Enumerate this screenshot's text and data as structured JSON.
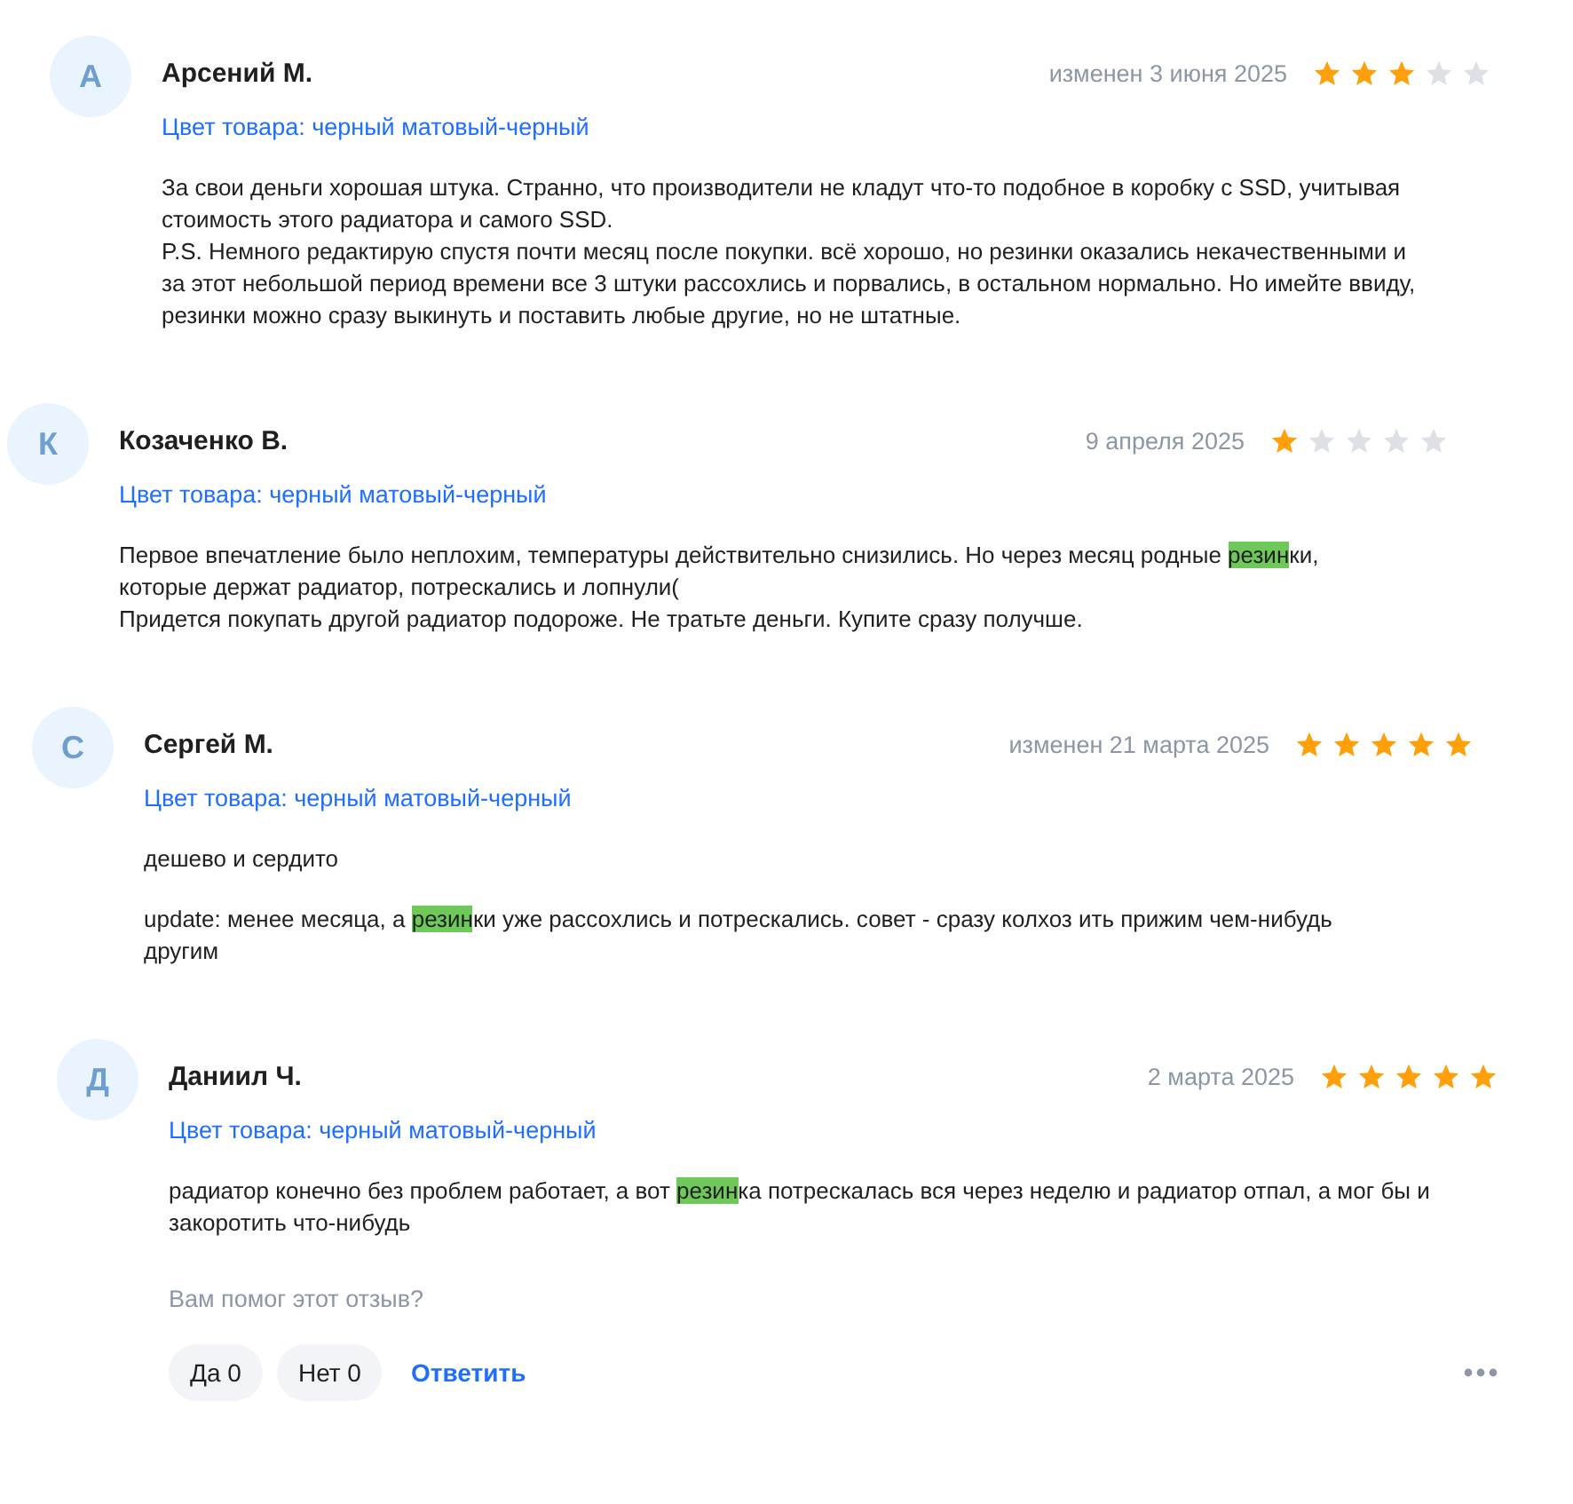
{
  "reviews": [
    {
      "avatar": "А",
      "author": "Арсений М.",
      "date": "изменен 3 июня 2025",
      "stars": 3,
      "variant": "Цвет товара: черный матовый-черный",
      "paragraphs": [
        [
          [
            {
              "text": "За свои деньги хорошая штука. Странно, что производители не кладут что-то подобное в коробку с SSD, учитывая стоимость этого радиатора и самого SSD.",
              "highlighted": false
            }
          ],
          [
            {
              "text": "P.S. Немного редактирую спустя почти месяц после покупки. всё хорошо, но резинки оказались некачественными и за этот небольшой период времени все 3 штуки рассохлись и порвались, в остальном нормально. Но имейте ввиду, резинки можно сразу выкинуть и поставить любые другие, но не штатные.",
              "highlighted": false
            }
          ]
        ]
      ]
    },
    {
      "avatar": "К",
      "author": "Козаченко В.",
      "date": "9 апреля 2025",
      "stars": 1,
      "variant": "Цвет товара: черный матовый-черный",
      "paragraphs": [
        [
          [
            {
              "text": "Первое впечатление было неплохим, температуры действительно снизились. Но через месяц родные ",
              "highlighted": false
            },
            {
              "text": "резин",
              "highlighted": true
            },
            {
              "text": "ки, которые держат радиатор, потрескались и лопнули(",
              "highlighted": false
            }
          ],
          [
            {
              "text": "Придется покупать другой радиатор подороже. Не тратьте деньги. Купите сразу получше.",
              "highlighted": false
            }
          ]
        ]
      ]
    },
    {
      "avatar": "С",
      "author": "Сергей М.",
      "date": "изменен 21 марта 2025",
      "stars": 5,
      "variant": "Цвет товара: черный матовый-черный",
      "paragraphs": [
        [
          [
            {
              "text": "дешево и сердито",
              "highlighted": false
            }
          ]
        ],
        [
          [
            {
              "text": "update: менее месяца, а ",
              "highlighted": false
            },
            {
              "text": "резин",
              "highlighted": true
            },
            {
              "text": "ки уже рассохлись и потрескались. совет - сразу колхоз ить прижим чем-нибудь другим",
              "highlighted": false
            }
          ]
        ]
      ]
    },
    {
      "avatar": "Д",
      "author": "Даниил Ч.",
      "date": "2 марта 2025",
      "stars": 5,
      "variant": "Цвет товара: черный матовый-черный",
      "paragraphs": [
        [
          [
            {
              "text": "радиатор конечно без проблем работает, а вот ",
              "highlighted": false
            },
            {
              "text": "резин",
              "highlighted": true
            },
            {
              "text": "ка потрескалась вся через неделю и радиатор отпал, а мог бы и закоротить что-нибудь",
              "highlighted": false
            }
          ]
        ]
      ],
      "feedback": {
        "question": "Вам помог этот отзыв?",
        "yes": "Да 0",
        "no": "Нет 0",
        "reply": "Ответить"
      }
    }
  ]
}
